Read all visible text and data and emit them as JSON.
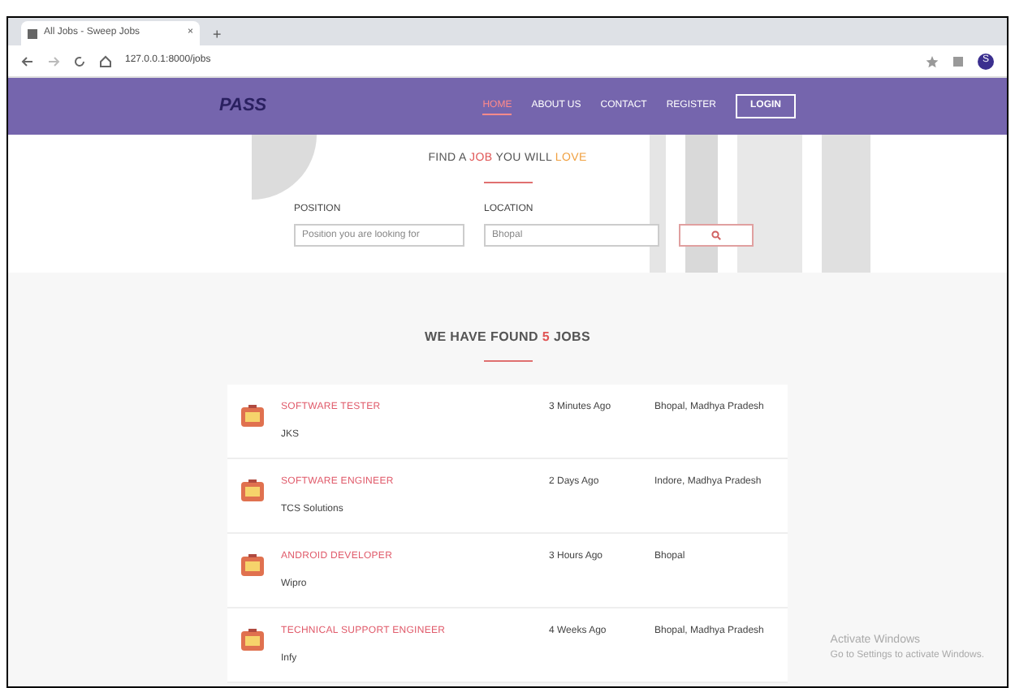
{
  "browser": {
    "tab_title": "All Jobs - Sweep Jobs",
    "tab_close": "×",
    "new_tab": "+",
    "url": "127.0.0.1:8000/jobs",
    "profile": "S"
  },
  "header": {
    "logo": "PASS",
    "nav": [
      {
        "label": "HOME",
        "selected": true,
        "kind": "link"
      },
      {
        "label": "ABOUT US",
        "selected": false,
        "kind": "link"
      },
      {
        "label": "CONTACT",
        "selected": false,
        "kind": "link"
      },
      {
        "label": "REGISTER",
        "selected": false,
        "kind": "link"
      },
      {
        "label": "LOGIN",
        "selected": false,
        "kind": "button"
      }
    ]
  },
  "hero": {
    "heading_parts": [
      {
        "text": "FIND A",
        "kind": "plain"
      },
      {
        "text": "JOB",
        "kind": "red"
      },
      {
        "text": "YOU WILL",
        "kind": "plain"
      },
      {
        "text": "LOVE",
        "kind": "orange"
      }
    ],
    "position": {
      "label": "POSITION",
      "placeholder": "Position you are looking for"
    },
    "location": {
      "label": "LOCATION",
      "placeholder": "Bhopal"
    }
  },
  "results": {
    "parts": [
      {
        "text": "WE HAVE FOUND",
        "kind": "plain"
      },
      {
        "text": "5",
        "kind": "red"
      },
      {
        "text": "JOBS",
        "kind": "plain"
      }
    ]
  },
  "jobs": [
    {
      "title": "SOFTWARE TESTER",
      "company": "JKS",
      "posted": "3 Minutes Ago",
      "location": "Bhopal, Madhya Pradesh"
    },
    {
      "title": "SOFTWARE ENGINEER",
      "company": "TCS Solutions",
      "posted": "2 Days Ago",
      "location": "Indore, Madhya Pradesh"
    },
    {
      "title": "ANDROID DEVELOPER",
      "company": "Wipro",
      "posted": "3 Hours Ago",
      "location": "Bhopal"
    },
    {
      "title": "TECHNICAL SUPPORT ENGINEER",
      "company": "Infy",
      "posted": "4 Weeks Ago",
      "location": "Bhopal, Madhya Pradesh"
    }
  ],
  "os_notice": {
    "title": "Activate Windows",
    "body": "Go to Settings to activate Windows."
  }
}
